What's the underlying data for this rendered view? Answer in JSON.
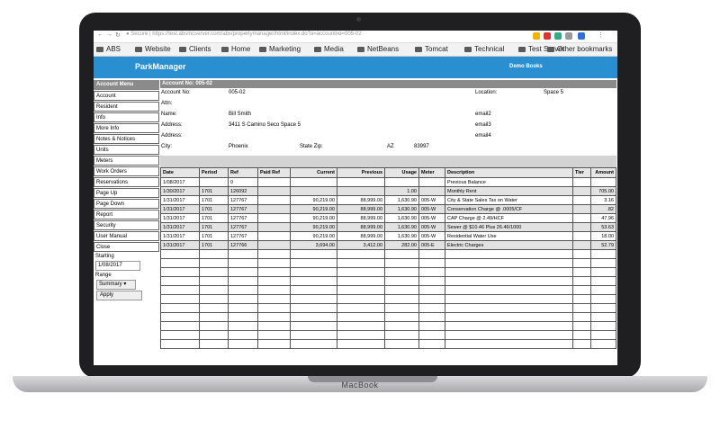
{
  "browser": {
    "url": "● Secure | https://test.absmcserver.com/abs/propertymanager/html/index.do?a=accountno=005-02",
    "bookmarks": [
      "ABS",
      "Website",
      "Clients",
      "Home",
      "Marketing",
      "Media",
      "NetBeans",
      "Tomcat",
      "Technical",
      "Test Server"
    ],
    "other_bookmarks": "Other bookmarks"
  },
  "app": {
    "title": "ParkManager",
    "company": "Demo Books"
  },
  "device": {
    "brand": "MacBook"
  },
  "menu": {
    "header": "Account Menu",
    "items": [
      "Account",
      "Resident",
      "Info",
      "More Info",
      "Notes & Notices",
      "Units",
      "Meters",
      "Work Orders",
      "Reservations",
      "Page Up",
      "Page Down",
      "Report",
      "Security",
      "User Manual",
      "Close"
    ],
    "starting_label": "Starting",
    "starting_value": "1/08/2017",
    "range_label": "Range",
    "range_value": "Summary ▾",
    "apply_label": "Apply"
  },
  "account": {
    "header": "Account No: 005-02",
    "account_no_label": "Account No:",
    "account_no": "005-02",
    "location_label": "Location:",
    "location": "Space 5",
    "attn_label": "Attn:",
    "name_label": "Name:",
    "name": "Bill Smith",
    "email2_label": "email2",
    "address_label": "Address:",
    "address": "3411 S Camino Seco Space 5",
    "email3_label": "email3",
    "address2_label": "Address:",
    "email4_label": "email4",
    "city_label": "City:",
    "city": "Phoenix",
    "statezip_label": "State Zip:",
    "state": "AZ",
    "zip": "83997"
  },
  "ledger": {
    "columns": [
      "Date",
      "Period",
      "Ref",
      "Paid Ref",
      "Current",
      "Previous",
      "Usage",
      "Meter",
      "Description",
      "Tier",
      "Amount"
    ],
    "rows": [
      [
        "1/08/2017",
        "",
        "0",
        "",
        "",
        "",
        "",
        "",
        "Previous Balance",
        "",
        ""
      ],
      [
        "1/30/2017",
        "1701",
        "126092",
        "",
        "",
        "",
        "1.00",
        "",
        "Monthly Rent",
        "",
        "705.00"
      ],
      [
        "1/31/2017",
        "1701",
        "127767",
        "",
        "90,219.00",
        "88,999.00",
        "1,630.90",
        "005-W",
        "City & State Sales Tax on Water",
        "",
        "3.16"
      ],
      [
        "1/31/2017",
        "1701",
        "127767",
        "",
        "90,219.00",
        "88,999.00",
        "1,630.90",
        "005-W",
        "Conservation Charge @ .0005/CF",
        "",
        ".82"
      ],
      [
        "1/31/2017",
        "1701",
        "127767",
        "",
        "90,219.00",
        "88,999.00",
        "1,630.90",
        "005-W",
        "CAP Charge @ 2.49/HCF",
        "",
        "47.96"
      ],
      [
        "1/31/2017",
        "1701",
        "127767",
        "",
        "90,219.00",
        "88,999.00",
        "1,630.90",
        "005-W",
        "Sewer @ $10.46 Plus 26.46/1000",
        "",
        "53.63"
      ],
      [
        "1/31/2017",
        "1701",
        "127767",
        "",
        "90,219.00",
        "88,999.00",
        "1,630.90",
        "005-W",
        "Residential Water Use",
        "",
        "18.00"
      ],
      [
        "1/31/2017",
        "1701",
        "127766",
        "",
        "3,694.00",
        "3,412.00",
        "282.00",
        "005-E",
        "Electric Charges",
        "",
        "52.79"
      ]
    ],
    "empty_rows": 11
  }
}
